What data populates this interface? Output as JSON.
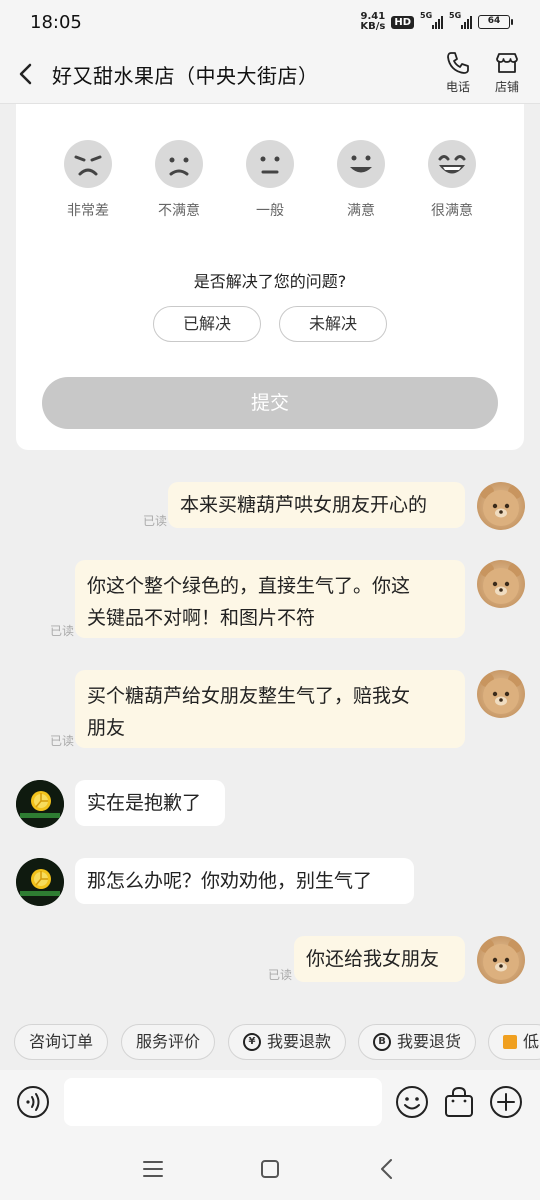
{
  "status": {
    "time": "18:05",
    "net_speed_top": "9.41",
    "net_speed_bottom": "KB/s",
    "hd": "HD",
    "sig1": "5G",
    "sig2": "5G",
    "battery": "64"
  },
  "header": {
    "title": "好又甜水果店（中央大街店）",
    "phone_label": "电话",
    "store_label": "店铺"
  },
  "rating": {
    "faces": [
      "非常差",
      "不满意",
      "一般",
      "满意",
      "很满意"
    ],
    "question": "是否解决了您的问题?",
    "resolved": "已解决",
    "unresolved": "未解决",
    "submit": "提交"
  },
  "messages": [
    {
      "from": "me",
      "text": "本来买糖葫芦哄女朋友开心的",
      "read": "已读"
    },
    {
      "from": "me",
      "line1": "你这个整个绿色的，直接生气了。你这",
      "line2": "关键品不对啊！和图片不符",
      "read": "已读"
    },
    {
      "from": "me",
      "line1": "买个糖葫芦给女朋友整生气了，赔我女",
      "line2": "朋友",
      "read": "已读"
    },
    {
      "from": "shop",
      "text": "实在是抱歉了"
    },
    {
      "from": "shop",
      "text": "那怎么办呢？你劝劝他，别生气了"
    },
    {
      "from": "me",
      "text": "你还给我女朋友",
      "read": "已读"
    }
  ],
  "quick_actions": [
    "咨询订单",
    "服务评价",
    "我要退款",
    "我要退货",
    "低"
  ],
  "input": {
    "placeholder": ""
  },
  "colors": {
    "my_bubble": "#fdf7e6",
    "submit_disabled": "#c8c8c8"
  }
}
